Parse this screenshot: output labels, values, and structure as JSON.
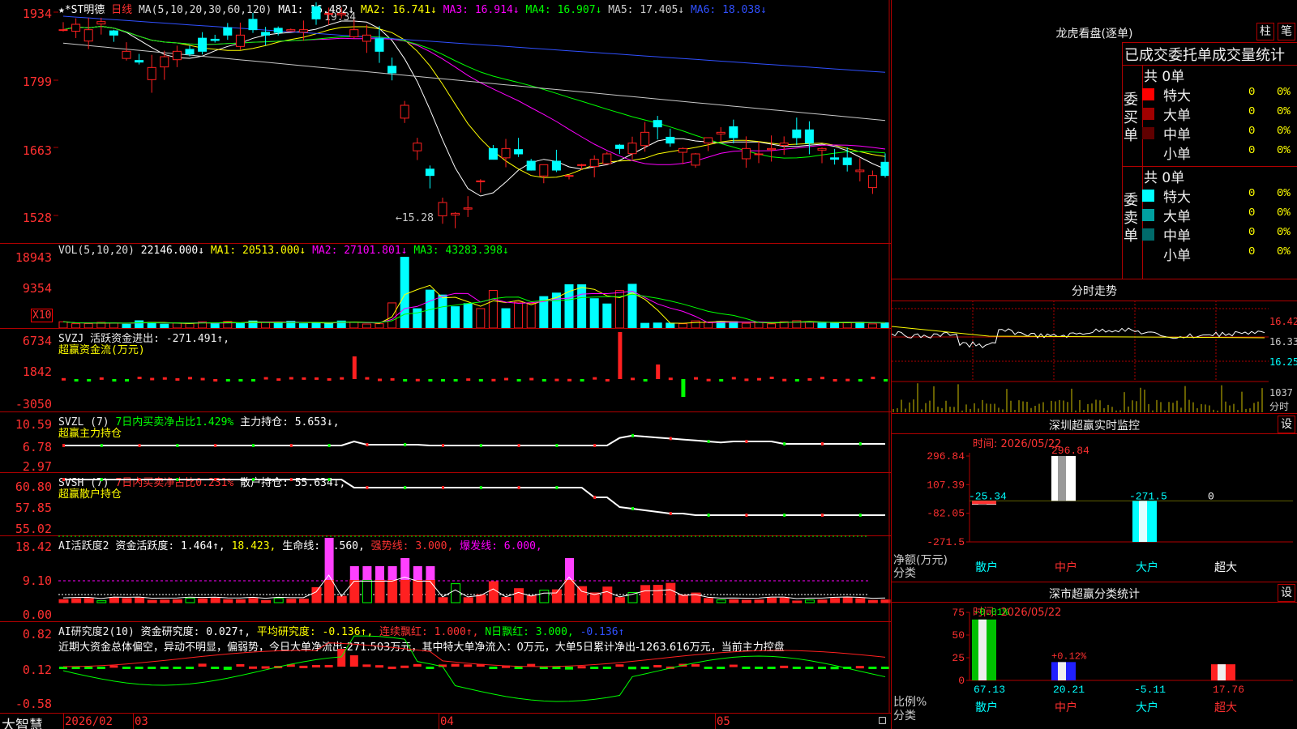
{
  "stock": {
    "title": "★*ST明德",
    "period": "日线",
    "ma_header": "MA(5,10,20,30,60,120)",
    "ma": [
      {
        "label": "MA1: 16.482↓",
        "color": "#ffffff"
      },
      {
        "label": "MA2: 16.741↓",
        "color": "#ffff00"
      },
      {
        "label": "MA3: 16.914↓",
        "color": "#ff00ff"
      },
      {
        "label": "MA4: 16.907↓",
        "color": "#00ff00"
      },
      {
        "label": "MA5: 17.405↓",
        "color": "#c8c8c8"
      },
      {
        "label": "MA6: 18.038↓",
        "color": "#3050ff"
      }
    ],
    "high_note": "19.34",
    "low_note": "←15.28",
    "y_ticks": [
      "1934",
      "1799",
      "1663",
      "1528"
    ]
  },
  "volume": {
    "header": "VOL(5,10,20)",
    "value": "22146.000↓",
    "mas": [
      {
        "label": "MA1: 20513.000↓",
        "color": "#ffff00"
      },
      {
        "label": "MA2: 27101.801↓",
        "color": "#ff00ff"
      },
      {
        "label": "MA3: 43283.398↓",
        "color": "#00ff00"
      }
    ],
    "y_ticks": [
      "18943",
      "9354"
    ],
    "unit": "X10"
  },
  "svzj": {
    "header": "SVZJ  活跃资金进出: -271.491↑,",
    "sub": "超赢资金流(万元)",
    "y_ticks": [
      "6734",
      "1842",
      "-3050"
    ]
  },
  "svzl": {
    "name": "SVZL (7)",
    "ratio": "7日内买卖净占比1.429%",
    "holding": "主力持仓: 5.653↓,",
    "sub": "超赢主力持仓",
    "y_ticks": [
      "10.59",
      "6.78",
      "2.97"
    ]
  },
  "svsh": {
    "name": "SVSH (7)",
    "ratio": "7日内买卖净占比0.231%",
    "holding": "散户持仓: 55.634↓,",
    "sub": "超赢散户持仓",
    "y_ticks": [
      "60.80",
      "57.85",
      "55.02"
    ]
  },
  "ai_active": {
    "name": "AI活跃度2",
    "a": "资金活跃度: 1.464↑,",
    "b": "18.423,",
    "c": "生命线: 1.560,",
    "d": "强势线: 3.000,",
    "e": "爆发线: 6.000,",
    "y_ticks": [
      "18.42",
      "9.10",
      "0.00"
    ]
  },
  "ai_research": {
    "name": "AI研究度2(10)",
    "a": "资金研究度: 0.027↑,",
    "b": "平均研究度: -0.136↑,",
    "c": "连续飘红: 1.000↑,",
    "d": "N日飘红: 3.000,",
    "e": "-0.136↑",
    "comment": "近期大资金总体偏空，异动不明显，偏弱势，今日大单净流出-271.503万元，其中特大单净流入：0万元，大单5日累计净出-1263.616万元，当前主力控盘",
    "y_ticks": [
      "0.82",
      "0.12",
      "-0.58"
    ]
  },
  "bottom": {
    "brand": "大智慧",
    "dates": [
      "2026/02",
      "03",
      "04",
      "05"
    ]
  },
  "dragon": {
    "title": "龙虎看盘(逐单)",
    "btn1": "柱",
    "btn2": "笔",
    "stats_title": "已成交委托单成交量统计",
    "buy_label": "委买单",
    "sell_label": "委卖单",
    "buy_total": "共 0单",
    "sell_total": "共 0单",
    "buy_rows": [
      {
        "name": "特大",
        "value": "0",
        "pct": "0%",
        "color": "#ff0000"
      },
      {
        "name": "大单",
        "value": "0",
        "pct": "0%",
        "color": "#a00000"
      },
      {
        "name": "中单",
        "value": "0",
        "pct": "0%",
        "color": "#600000"
      },
      {
        "name": "小单",
        "value": "0",
        "pct": "0%",
        "color": "#000000"
      }
    ],
    "sell_rows": [
      {
        "name": "特大",
        "value": "0",
        "pct": "0%",
        "color": "#00ffff"
      },
      {
        "name": "大单",
        "value": "0",
        "pct": "0%",
        "color": "#00a0a0"
      },
      {
        "name": "中单",
        "value": "0",
        "pct": "0%",
        "color": "#006a6a"
      },
      {
        "name": "小单",
        "value": "0",
        "pct": "0%",
        "color": "#000000"
      }
    ]
  },
  "intraday": {
    "title": "分时走势",
    "y_ticks": [
      "16.42",
      "16.33",
      "16.25"
    ],
    "vol_top": "1037",
    "vol_unit": "分时"
  },
  "monitor": {
    "title": "深圳超赢实时监控",
    "btn": "设",
    "time": "时间: 2026/05/22",
    "y_ticks": [
      "296.84",
      "107.39",
      "-82.05",
      "-271.5"
    ],
    "ylabel": "净额(万元)",
    "xlabel": "分类",
    "categories": [
      "散户",
      "中户",
      "大户",
      "超大"
    ],
    "value_labels": [
      "-25.34",
      "296.84",
      "-271.5",
      "0"
    ]
  },
  "classify": {
    "title": "深市超赢分类统计",
    "btn": "设",
    "time": "时间: 2026/05/22",
    "y_ticks": [
      "75",
      "50",
      "25",
      "0"
    ],
    "ylabel": "比例%",
    "xlabel": "分类",
    "categories": [
      "散户",
      "中户",
      "大户",
      "超大"
    ],
    "top_labels": [
      "-0.01%",
      "+0.12%"
    ],
    "bottom_labels": [
      "67.13",
      "20.21",
      "-5.11",
      "17.76"
    ]
  },
  "chart_data": [
    {
      "type": "bar",
      "title": "深圳超赢实时监控",
      "ylabel": "净额(万元)",
      "xlabel": "分类",
      "categories": [
        "散户",
        "中户",
        "大户",
        "超大"
      ],
      "values": [
        -25.34,
        296.84,
        -271.5,
        0
      ],
      "ylim": [
        -271.5,
        296.84
      ]
    },
    {
      "type": "bar",
      "title": "深市超赢分类统计",
      "ylabel": "比例%",
      "xlabel": "分类",
      "categories": [
        "散户",
        "中户",
        "大户",
        "超大"
      ],
      "values": [
        67.13,
        20.21,
        -5.11,
        17.76
      ],
      "ylim": [
        0,
        75
      ]
    }
  ]
}
